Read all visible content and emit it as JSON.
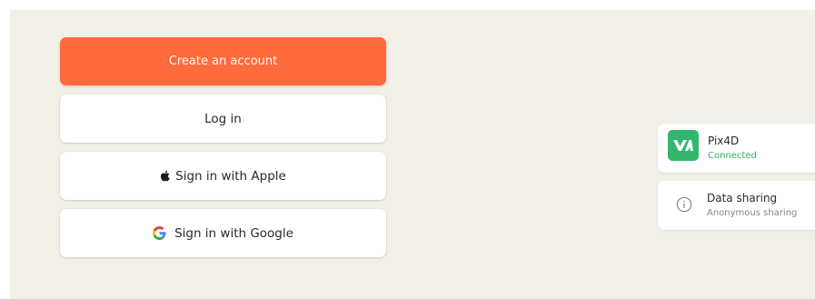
{
  "auth": {
    "create_account_label": "Create an account",
    "login_label": "Log in",
    "apple_label": "Sign in with Apple",
    "google_label": "Sign in with Google"
  },
  "integrations": [
    {
      "name": "Pix4D",
      "status": "Connected",
      "icon": "pix4d-logo-icon",
      "status_color": "#2fae62"
    },
    {
      "name": "Data sharing",
      "status": "Anonymous sharing",
      "icon": "info-icon",
      "status_color": "#8a877f"
    }
  ],
  "colors": {
    "background": "#f2efe6",
    "accent": "#ff6b3d",
    "card": "#ffffff",
    "text": "#2d2a26",
    "success": "#2fae62"
  }
}
